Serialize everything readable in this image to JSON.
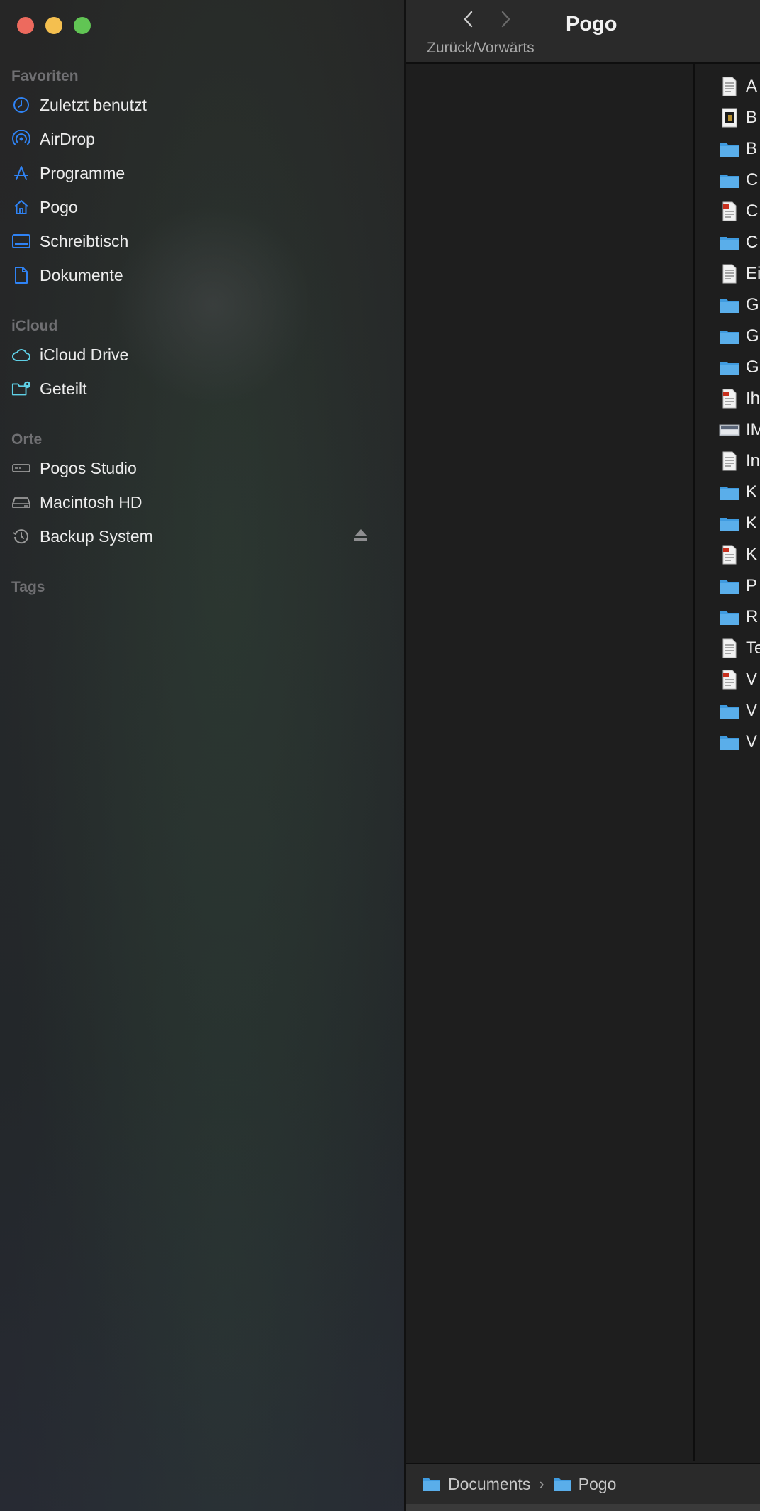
{
  "window": {
    "title": "Pogo"
  },
  "toolbar": {
    "nav_caption": "Zurück/Vorwärts"
  },
  "colors": {
    "accent": "#2f83f5",
    "folder": "#5aaeea",
    "cloud": "#5fd0e6"
  },
  "sidebar": {
    "favorites_title": "Favoriten",
    "favorites": [
      {
        "label": "Zuletzt benutzt",
        "icon": "clock-icon"
      },
      {
        "label": "AirDrop",
        "icon": "airdrop-icon"
      },
      {
        "label": "Programme",
        "icon": "apps-icon"
      },
      {
        "label": "Pogo",
        "icon": "home-icon"
      },
      {
        "label": "Schreibtisch",
        "icon": "desktop-icon"
      },
      {
        "label": "Dokumente",
        "icon": "document-icon"
      }
    ],
    "icloud_title": "iCloud",
    "icloud": [
      {
        "label": "iCloud Drive",
        "icon": "cloud-icon"
      },
      {
        "label": "Geteilt",
        "icon": "shared-folder-icon"
      }
    ],
    "locations_title": "Orte",
    "locations": [
      {
        "label": "Pogos Studio",
        "icon": "computer-icon"
      },
      {
        "label": "Macintosh HD",
        "icon": "disk-icon"
      },
      {
        "label": "Backup System",
        "icon": "time-machine-icon",
        "eject": "eject-icon"
      }
    ],
    "tags_title": "Tags"
  },
  "files": [
    {
      "initial": "A",
      "kind": "document"
    },
    {
      "initial": "B",
      "kind": "image"
    },
    {
      "initial": "B",
      "kind": "folder"
    },
    {
      "initial": "C",
      "kind": "folder"
    },
    {
      "initial": "C",
      "kind": "pdf"
    },
    {
      "initial": "C",
      "kind": "folder"
    },
    {
      "initial": "Ei",
      "kind": "document"
    },
    {
      "initial": "G",
      "kind": "folder"
    },
    {
      "initial": "G",
      "kind": "folder"
    },
    {
      "initial": "G",
      "kind": "folder"
    },
    {
      "initial": "Ih",
      "kind": "pdf"
    },
    {
      "initial": "IM",
      "kind": "screenshot"
    },
    {
      "initial": "In",
      "kind": "document"
    },
    {
      "initial": "K",
      "kind": "folder"
    },
    {
      "initial": "K",
      "kind": "folder"
    },
    {
      "initial": "K",
      "kind": "pdf"
    },
    {
      "initial": "P",
      "kind": "folder"
    },
    {
      "initial": "R",
      "kind": "folder"
    },
    {
      "initial": "Te",
      "kind": "document"
    },
    {
      "initial": "V",
      "kind": "pdf"
    },
    {
      "initial": "V",
      "kind": "folder"
    },
    {
      "initial": "V",
      "kind": "folder"
    }
  ],
  "pathbar": {
    "crumbs": [
      {
        "label": "Documents"
      },
      {
        "label": "Pogo"
      }
    ],
    "separator": "›"
  }
}
